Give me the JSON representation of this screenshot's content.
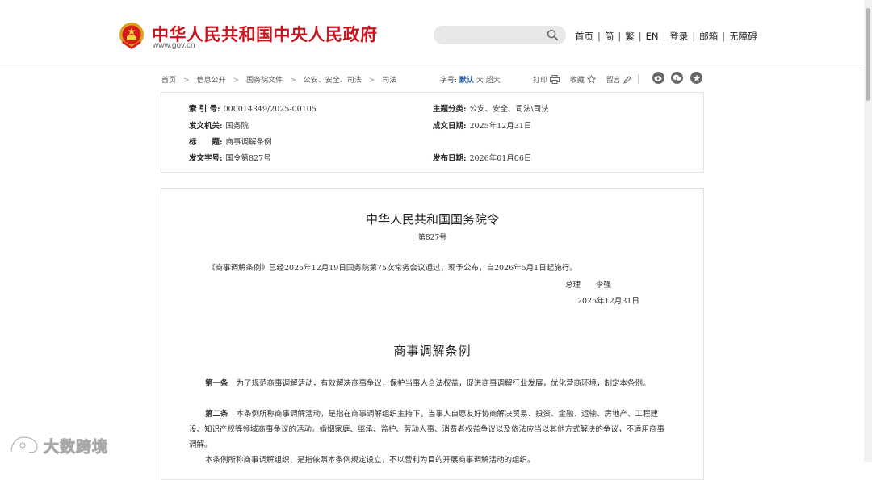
{
  "header": {
    "site_title": "中华人民共和国中央人民政府",
    "site_domain": "www.gov.cn",
    "search": {
      "placeholder": "",
      "value": ""
    },
    "nav": [
      "首页",
      "简",
      "繁",
      "EN",
      "登录",
      "邮箱",
      "无障碍"
    ]
  },
  "toolbar": {
    "breadcrumb": [
      "首页",
      "信息公开",
      "国务院文件",
      "公安、安全、司法",
      "司法"
    ],
    "font_size": {
      "label": "字号:",
      "options": [
        "默认",
        "大",
        "超大"
      ],
      "active": "默认"
    },
    "print_label": "打印",
    "favorite_label": "收藏",
    "comment_label": "留言"
  },
  "meta": {
    "index_no": {
      "label": "索 引 号:",
      "value": "000014349/2025-00105"
    },
    "category": {
      "label": "主题分类:",
      "value": "公安、安全、司法\\司法"
    },
    "issuer": {
      "label": "发文机关:",
      "value": "国务院"
    },
    "created": {
      "label": "成文日期:",
      "value": "2025年12月31日"
    },
    "title": {
      "label": "标　　题:",
      "value": "商事调解条例"
    },
    "doc_no": {
      "label": "发文字号:",
      "value": "国令第827号"
    },
    "published": {
      "label": "发布日期:",
      "value": "2026年01月06日"
    }
  },
  "document": {
    "title": "中华人民共和国国务院令",
    "number": "第827号",
    "decree_text": "《商事调解条例》已经2025年12月19日国务院第75次常务会议通过，现予公布，自2026年5月1日起施行。",
    "signer": "总理　　李强",
    "sign_date": "2025年12月31日",
    "regulation_title": "商事调解条例",
    "articles": [
      {
        "num": "第一条",
        "text": "为了规范商事调解活动，有效解决商事争议，保护当事人合法权益，促进商事调解行业发展，优化营商环境，制定本条例。"
      },
      {
        "num": "第二条",
        "text": "本条例所称商事调解活动，是指在商事调解组织主持下，当事人自愿友好协商解决贸易、投资、金融、运输、房地产、工程建设、知识产权等领域商事争议的活动。婚姻家庭、继承、监护、劳动人事、消费者权益争议以及依法应当以其他方式解决的争议，不适用商事调解。"
      },
      {
        "num": "",
        "text": "本条例所称商事调解组织，是指依照本条例规定设立，不以营利为目的开展商事调解活动的组织。"
      }
    ]
  },
  "watermark": {
    "text": "大数跨境"
  },
  "colors": {
    "brand_red": "#c8141e",
    "accent_blue": "#1f5fa8"
  }
}
